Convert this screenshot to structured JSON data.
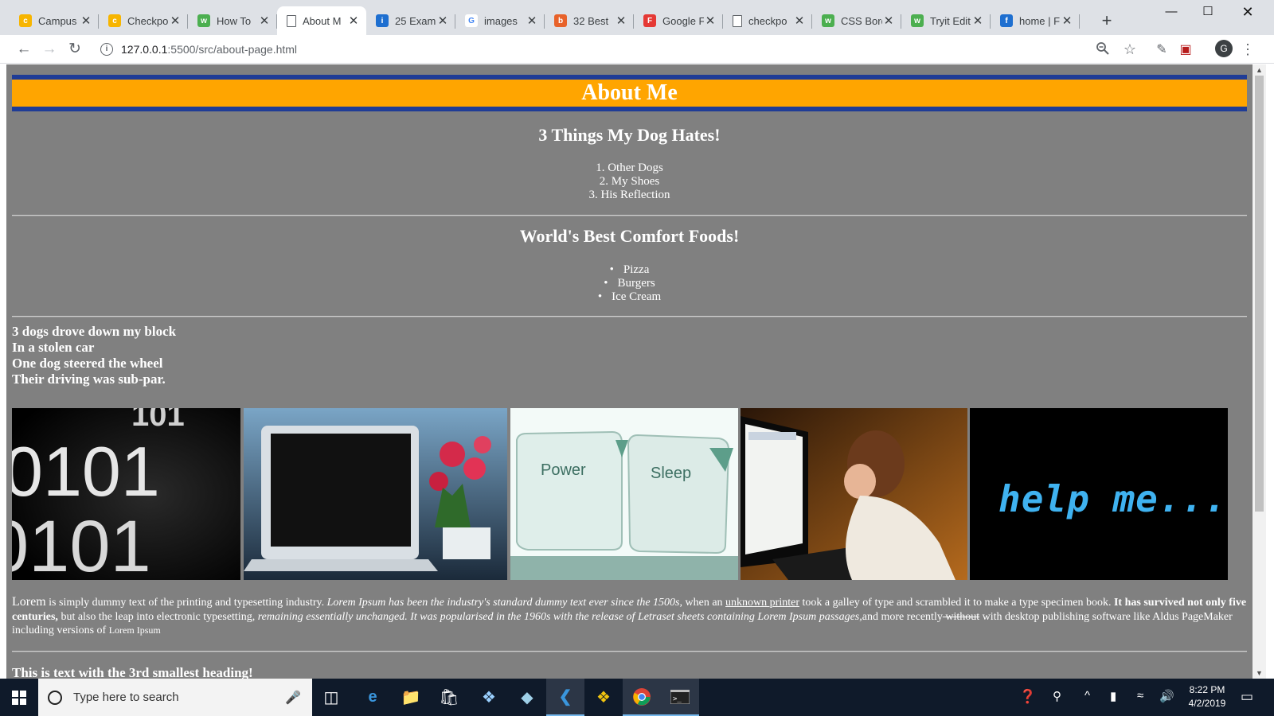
{
  "browser": {
    "tabs": [
      {
        "title": "Campus",
        "favicon_color": "#f7b500",
        "favicon_glyph": "c"
      },
      {
        "title": "Checkpo",
        "favicon_color": "#f7b500",
        "favicon_glyph": "c"
      },
      {
        "title": "How To",
        "favicon_color": "#4caf50",
        "favicon_glyph": "w"
      },
      {
        "title": "About M",
        "favicon_color": "#ffffff",
        "favicon_glyph": "page"
      },
      {
        "title": "25 Exam",
        "favicon_color": "#1e6fd0",
        "favicon_glyph": "i"
      },
      {
        "title": "images",
        "favicon_color": "#ffffff",
        "favicon_glyph": "G"
      },
      {
        "title": "32 Best",
        "favicon_color": "#e8622a",
        "favicon_glyph": "b"
      },
      {
        "title": "Google F",
        "favicon_color": "#e53935",
        "favicon_glyph": "F"
      },
      {
        "title": "checkpo",
        "favicon_color": "#ffffff",
        "favicon_glyph": "page"
      },
      {
        "title": "CSS Bord",
        "favicon_color": "#4caf50",
        "favicon_glyph": "w"
      },
      {
        "title": "Tryit Edit",
        "favicon_color": "#4caf50",
        "favicon_glyph": "w"
      },
      {
        "title": "home | F",
        "favicon_color": "#1e6fd0",
        "favicon_glyph": "f"
      }
    ],
    "active_tab": 3,
    "url_host": "127.0.0.1",
    "url_path": ":5500/src/about-page.html",
    "avatar_letter": "G"
  },
  "page": {
    "banner": "About Me",
    "dog_heading": "3 Things My Dog Hates!",
    "dog_list": [
      "1. Other Dogs",
      "2. My Shoes",
      "3. His Reflection"
    ],
    "food_heading": "World's Best Comfort Foods!",
    "food_list": [
      "Pizza",
      "Burgers",
      "Ice Cream"
    ],
    "poem": [
      "3 dogs drove down my block",
      "In a stolen car",
      "One dog steered the wheel",
      "Their driving was sub-par."
    ],
    "images": [
      {
        "caption": "binary-digits"
      },
      {
        "caption": "laptop-with-flowers"
      },
      {
        "caption": "power-sleep-keys",
        "key1": "Power",
        "key2": "Sleep"
      },
      {
        "caption": "baby-at-computer"
      },
      {
        "caption": "help-me-screen",
        "text": "help me..."
      }
    ],
    "paragraph": {
      "p1": "Lorem",
      "p2": " is simply dummy text of the printing and typesetting industry. ",
      "p3": "Lorem Ipsum has been the industry's standard dummy text ever since the 1500s,",
      "p4": " when an ",
      "p5": "unknown printer",
      "p6": " took a galley of type and scrambled it to make a type specimen book. ",
      "p7": "It has survived not only five centuries,",
      "p8": " but also the leap into electronic typesetting, ",
      "p9": "remaining essentially unchanged. It was popularised in the 1960s with the release of Letraset sheets containing Lorem Ipsum passages,",
      "p10": "and more recently",
      "p11": " without",
      "p12": " with desktop publishing software like Aldus PageMaker including versions of ",
      "p13": "Lorem Ipsum"
    },
    "h3_text": "This is text with the 3rd smallest heading!"
  },
  "taskbar": {
    "search_placeholder": "Type here to search",
    "time": "8:22 PM",
    "date": "4/2/2019"
  }
}
